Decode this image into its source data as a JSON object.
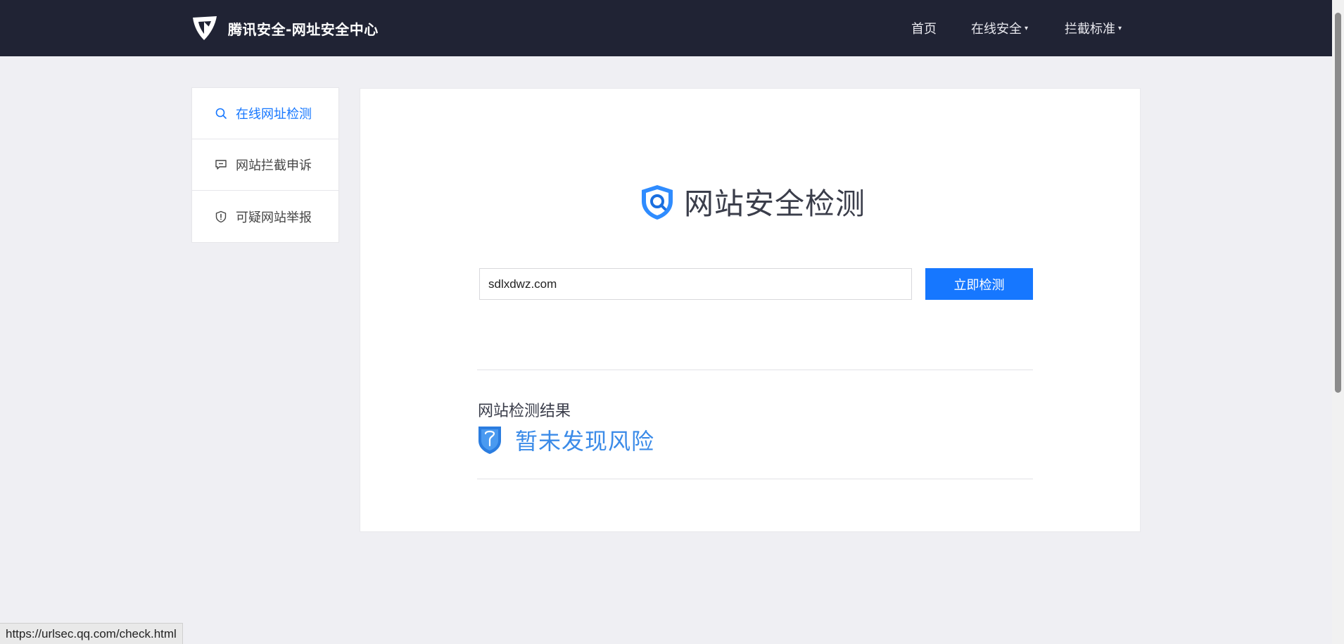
{
  "header": {
    "brand_title": "腾讯安全-网址安全中心",
    "logo_icon": "tencent-security-logo",
    "nav": [
      {
        "label": "首页",
        "has_caret": false
      },
      {
        "label": "在线安全",
        "has_caret": true
      },
      {
        "label": "拦截标准",
        "has_caret": true
      }
    ],
    "caret_glyph": "▾"
  },
  "sidebar": {
    "items": [
      {
        "label": "在线网址检测",
        "icon": "search-icon",
        "active": true
      },
      {
        "label": "网站拦截申诉",
        "icon": "chat-icon",
        "active": false
      },
      {
        "label": "可疑网站举报",
        "icon": "shield-alert-icon",
        "active": false
      }
    ]
  },
  "main": {
    "title": "网站安全检测",
    "title_icon": "shield-search-icon",
    "search": {
      "value": "sdlxdwz.com",
      "button_label": "立即检测"
    },
    "result": {
      "heading": "网站检测结果",
      "icon": "shield-question-icon",
      "status_text": "暂未发现风险"
    }
  },
  "status_bar": {
    "url": "https://urlsec.qq.com/check.html"
  },
  "colors": {
    "header_bg": "#202334",
    "page_bg": "#efeff3",
    "accent": "#1677ff",
    "result_blue": "#3b8be8"
  }
}
